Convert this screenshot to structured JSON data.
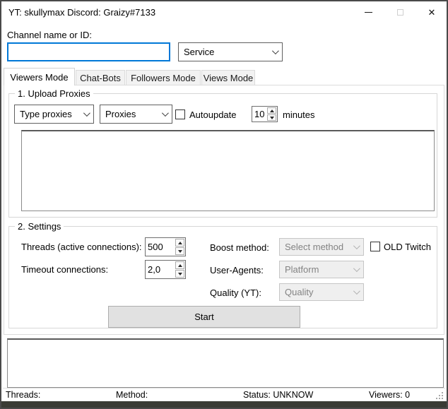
{
  "window": {
    "title": "YT: skullymax Discord: Graizy#7133",
    "close_glyph": "✕"
  },
  "header": {
    "channel_label": "Channel name or ID:",
    "channel_value": "",
    "service_value": "Service"
  },
  "tabs": [
    {
      "label": "Viewers Mode",
      "active": true
    },
    {
      "label": "Chat-Bots",
      "active": false
    },
    {
      "label": "Followers Mode",
      "active": false
    },
    {
      "label": "Views Mode",
      "active": false
    }
  ],
  "upload_proxies": {
    "group_title": "1. Upload Proxies",
    "type_proxies_value": "Type proxies",
    "proxies_value": "Proxies",
    "autoupdate_label": "Autoupdate",
    "autoupdate_checked": false,
    "interval_value": "10",
    "interval_unit": "minutes",
    "proxy_list_content": ""
  },
  "settings": {
    "group_title": "2. Settings",
    "threads_label": "Threads (active connections):",
    "threads_value": "500",
    "timeout_label": "Timeout connections:",
    "timeout_value": "2,0",
    "boost_label": "Boost method:",
    "boost_value": "Select method",
    "old_twitch_label": "OLD Twitch",
    "old_twitch_checked": false,
    "user_agents_label": "User-Agents:",
    "user_agents_value": "Platform",
    "quality_label": "Quality (YT):",
    "quality_value": "Quality",
    "start_label": "Start"
  },
  "log_content": "",
  "status_bar": {
    "threads": "Threads:",
    "method": "Method:",
    "status": "Status: UNKNOW",
    "viewers": "Viewers: 0"
  },
  "colors": {
    "focus_border": "#0078d7",
    "disabled_text": "#838383",
    "window_border": "#4a4a4a"
  }
}
